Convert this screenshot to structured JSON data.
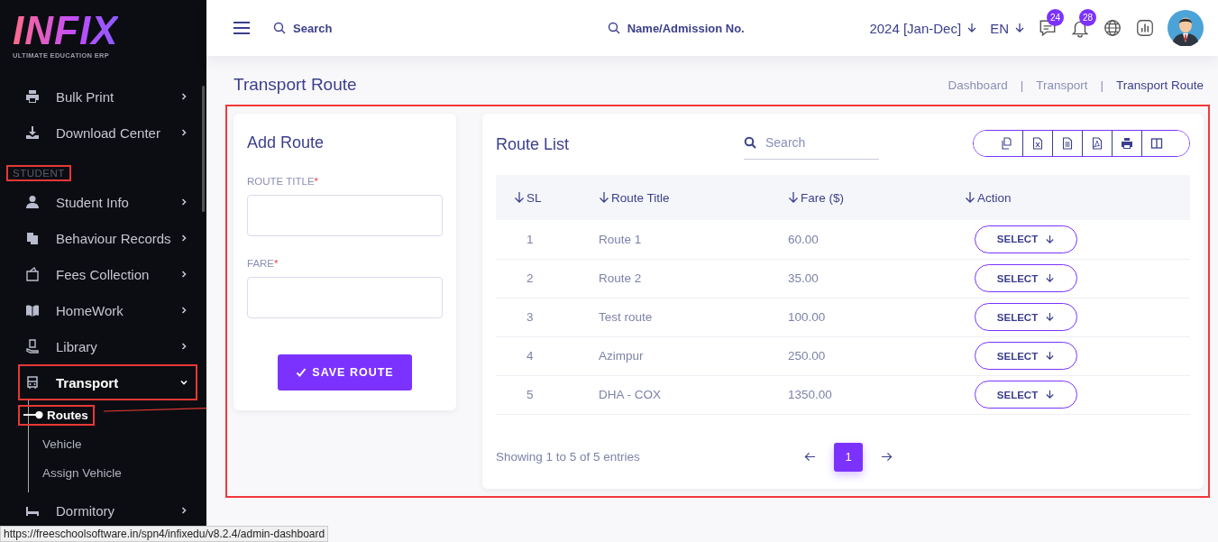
{
  "sidebar": {
    "logo": {
      "title": "INFIX",
      "subtitle": "ULTIMATE EDUCATION ERP"
    },
    "items": [
      {
        "kind": "item",
        "label": "Bulk Print",
        "expanded": false,
        "highlighted": false
      },
      {
        "kind": "item",
        "label": "Download Center",
        "expanded": false,
        "highlighted": false
      },
      {
        "kind": "section",
        "label": "STUDENT",
        "highlighted": true
      },
      {
        "kind": "item",
        "label": "Student Info",
        "expanded": false,
        "highlighted": false
      },
      {
        "kind": "item",
        "label": "Behaviour Records",
        "expanded": false,
        "highlighted": false
      },
      {
        "kind": "item",
        "label": "Fees Collection",
        "expanded": false,
        "highlighted": false
      },
      {
        "kind": "item",
        "label": "HomeWork",
        "expanded": false,
        "highlighted": false
      },
      {
        "kind": "item",
        "label": "Library",
        "expanded": false,
        "highlighted": false
      },
      {
        "kind": "item",
        "label": "Transport",
        "expanded": true,
        "highlighted": true,
        "children": [
          {
            "label": "Routes",
            "selected": true,
            "highlighted": true
          },
          {
            "label": "Vehicle",
            "selected": false,
            "highlighted": false
          },
          {
            "label": "Assign Vehicle",
            "selected": false,
            "highlighted": false
          }
        ]
      },
      {
        "kind": "item",
        "label": "Dormitory",
        "expanded": false,
        "highlighted": false
      }
    ]
  },
  "header": {
    "search": {
      "placeholder": "Search"
    },
    "student_search": {
      "placeholder": "Name/Admission No."
    },
    "session": "2024 [Jan-Dec]",
    "language": "EN",
    "messages_badge": "24",
    "notifications_badge": "28"
  },
  "page": {
    "title": "Transport Route",
    "breadcrumb_separator": "|",
    "breadcrumbs": [
      {
        "label": "Dashboard",
        "selected": false
      },
      {
        "label": "Transport",
        "selected": false
      },
      {
        "label": "Transport Route",
        "selected": true
      }
    ],
    "content_highlighted": true
  },
  "form": {
    "title": "Add Route",
    "fields": [
      {
        "label": "ROUTE TITLE",
        "required_mark": "*"
      },
      {
        "label": "FARE",
        "required_mark": "*"
      }
    ],
    "submit": "SAVE ROUTE"
  },
  "table": {
    "title": "Route List",
    "search": {
      "placeholder": "Search"
    },
    "columns": [
      "SL",
      "Route Title",
      "Fare ($)",
      "Action"
    ],
    "rows": [
      {
        "sl": "1",
        "title": "Route 1",
        "fare": "60.00",
        "action": "SELECT"
      },
      {
        "sl": "2",
        "title": "Route 2",
        "fare": "35.00",
        "action": "SELECT"
      },
      {
        "sl": "3",
        "title": "Test route",
        "fare": "100.00",
        "action": "SELECT"
      },
      {
        "sl": "4",
        "title": "Azimpur",
        "fare": "250.00",
        "action": "SELECT"
      },
      {
        "sl": "5",
        "title": "DHA - COX",
        "fare": "1350.00",
        "action": "SELECT"
      }
    ],
    "info": "Showing 1 to 5 of 5 entries",
    "pages": [
      {
        "label": "1",
        "selected": true
      }
    ]
  },
  "status_bar": {
    "url": "https://freeschoolsoftware.in/spn4/infixedu/v8.2.4/admin-dashboard"
  }
}
